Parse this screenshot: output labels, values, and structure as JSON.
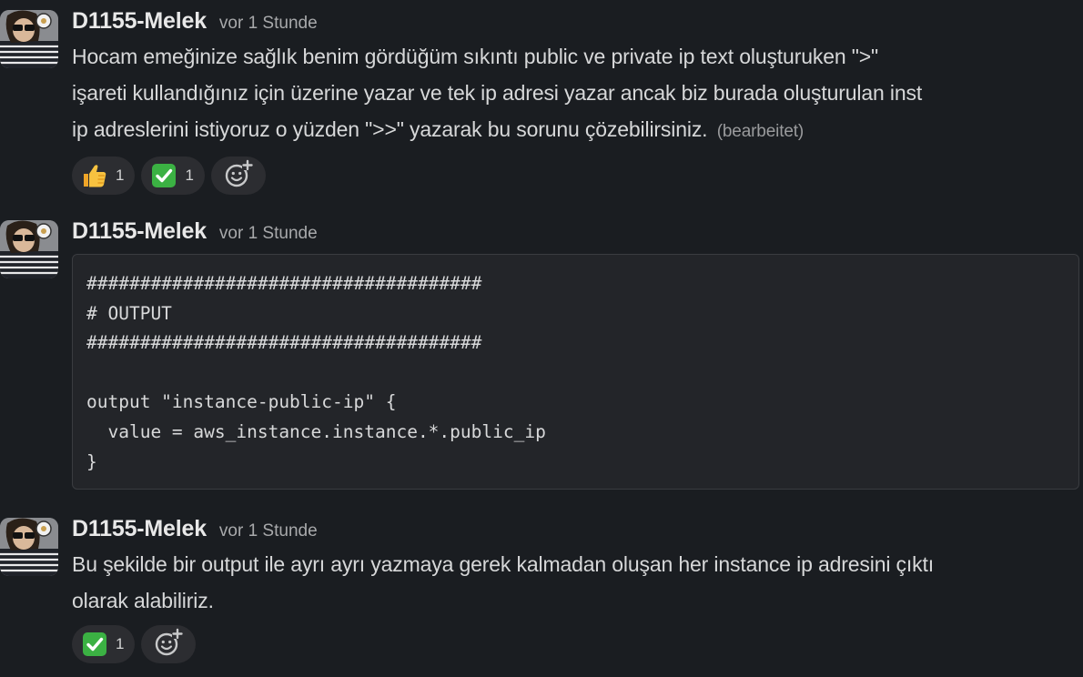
{
  "messages": [
    {
      "author": "D1155-Melek",
      "timestamp": "vor 1 Stunde",
      "lines": [
        "Hocam emeğinize sağlık benim gördüğüm sıkıntı public ve private ip text oluşturuken  \">\"",
        "işareti kullandığınız için üzerine yazar ve tek ip adresi yazar ancak biz burada oluşturulan inst",
        "ip adreslerini istiyoruz o yüzden \">>\" yazarak bu sorunu çözebilirsiniz."
      ],
      "edited": "(bearbeitet)",
      "reactions": [
        {
          "emoji": "thumbs-up",
          "count": "1"
        },
        {
          "emoji": "white-check-mark",
          "count": "1"
        }
      ]
    },
    {
      "author": "D1155-Melek",
      "timestamp": "vor 1 Stunde",
      "code": [
        "#####################################",
        "# OUTPUT",
        "#####################################",
        "",
        "output \"instance-public-ip\" {",
        "  value = aws_instance.instance.*.public_ip",
        "}"
      ]
    },
    {
      "author": "D1155-Melek",
      "timestamp": "vor 1 Stunde",
      "lines": [
        "Bu şekilde bir output ile ayrı ayrı yazmaya gerek kalmadan oluşan her instance ip adresini çıktı",
        "olarak alabiliriz."
      ],
      "reactions": [
        {
          "emoji": "white-check-mark",
          "count": "1"
        }
      ]
    }
  ],
  "colors": {
    "background": "#1a1d21",
    "reaction_bg": "#2c2d31",
    "code_bg": "#232529",
    "check_green": "#3bb143",
    "thumbs_yellow": "#f5b335"
  },
  "icons": {
    "add_reaction": "add-reaction-icon",
    "thumbs_up": "thumbs-up-icon",
    "check": "white-check-mark-icon"
  }
}
